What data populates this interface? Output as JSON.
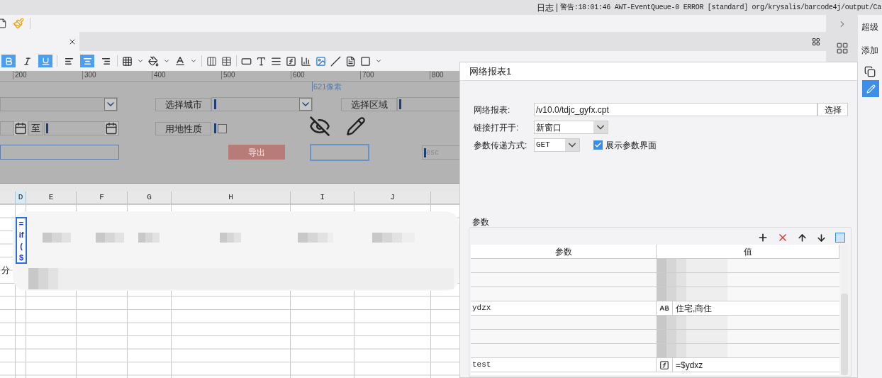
{
  "status_bar": {
    "log_label": "日志",
    "message": "警告:18:01:46 AWT-EventQueue-0 ERROR [standard] org/krysalis/barcode4j/output/Ca"
  },
  "side_panel": {
    "items": [
      "超级",
      "添加"
    ]
  },
  "format_toolbar": [
    {
      "kind": "bold",
      "selected": true
    },
    {
      "kind": "italic",
      "selected": false
    },
    {
      "kind": "underline",
      "selected": true
    },
    {
      "kind": "align-left",
      "selected": false
    },
    {
      "kind": "align-center",
      "selected": true
    },
    {
      "kind": "align-right",
      "selected": false
    }
  ],
  "ruler": {
    "ticks": [
      "200",
      "300",
      "400",
      "500",
      "600",
      "700",
      "800"
    ],
    "marker": "621像素"
  },
  "form": {
    "city_label": "选择城市",
    "area_label": "选择区域",
    "land_use_label": "用地性质",
    "land_use_checked": false,
    "range_separator": "至",
    "export_button": "导出",
    "esc_field": {
      "placeholder": "esc"
    }
  },
  "sheet": {
    "columns": [
      {
        "label": "D",
        "selected": true
      },
      {
        "label": "E",
        "selected": false
      },
      {
        "label": "F",
        "selected": false
      },
      {
        "label": "G",
        "selected": false
      },
      {
        "label": "H",
        "selected": false
      },
      {
        "label": "I",
        "selected": false
      },
      {
        "label": "J",
        "selected": false
      }
    ],
    "selected_cell_lines": [
      "=",
      "if",
      "(",
      "$"
    ],
    "side_text": "分"
  },
  "dialog": {
    "title": "网络报表1",
    "report_label": "网络报表:",
    "report_path": "/v10.0/tdjc_gyfx.cpt",
    "choose_button": "选择",
    "open_in_label": "链接打开于:",
    "open_in_value": "新窗口",
    "method_label": "参数传递方式:",
    "method_value": "GET",
    "show_params": {
      "label": "展示参数界面",
      "checked": true
    },
    "params": {
      "title": "参数",
      "columns": [
        "参数",
        "值"
      ],
      "rows": [
        {
          "redacted": true
        },
        {
          "redacted": true
        },
        {
          "redacted": true
        },
        {
          "redacted": false,
          "name": "ydzx",
          "kind": "text",
          "value": "住宅,商住"
        },
        {
          "redacted": true
        },
        {
          "redacted": true
        },
        {
          "redacted": true
        },
        {
          "redacted": false,
          "name": "test",
          "kind": "formula",
          "value": "=$ydxz"
        }
      ]
    }
  }
}
